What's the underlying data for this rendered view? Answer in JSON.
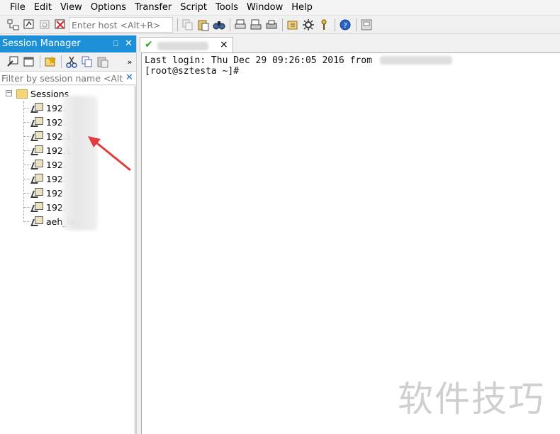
{
  "menubar": {
    "items": [
      "File",
      "Edit",
      "View",
      "Options",
      "Transfer",
      "Script",
      "Tools",
      "Window",
      "Help"
    ]
  },
  "toolbar": {
    "host_placeholder": "Enter host <Alt+R>"
  },
  "session_manager": {
    "title": "Session Manager",
    "filter_placeholder": "Filter by session name <Alt+I",
    "root_label": "Sessions",
    "sessions": [
      "192.",
      "192.",
      "192.1",
      "192.1",
      "192.",
      "192.",
      "192",
      "192.",
      "aeh_la"
    ]
  },
  "tab": {
    "close_glyph": "×"
  },
  "terminal": {
    "lines": [
      "Last login: Thu Dec 29 09:26:05 2016 from",
      "[root@sztesta ~]#"
    ]
  },
  "watermark": "软件技巧",
  "colors": {
    "accent": "#1e90d8",
    "terminal_bg": "#ffffff",
    "arrow": "#e23c3c",
    "watermark": "#cfcfcf"
  }
}
